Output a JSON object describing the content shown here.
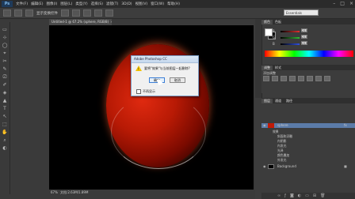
{
  "app": {
    "logo": "Ps"
  },
  "menu": [
    "文件(F)",
    "编辑(E)",
    "图像(I)",
    "图层(L)",
    "类型(Y)",
    "选择(S)",
    "滤镜(T)",
    "3D(D)",
    "视图(V)",
    "窗口(W)",
    "帮助(H)"
  ],
  "window_buttons": [
    "–",
    "□",
    "×"
  ],
  "options_bar": {
    "items": [
      "显示变换控件"
    ],
    "workspace": "Essentials"
  },
  "document": {
    "tab_title": "Untitled-1 @ 67.2% (sphere, RGB/8)",
    "close": "×"
  },
  "status_bar": {
    "zoom": "67%",
    "doc_info": "文档:2.63M/1.89M"
  },
  "dialog": {
    "title": "Adobe Photoshop CC",
    "message": "要将\"效果\"与当前图层一起删除?",
    "buttons": [
      "确定",
      "取消"
    ],
    "checkbox": "不再显示",
    "warning_glyph": "!"
  },
  "color_panel": {
    "tabs": [
      "颜色",
      "色板"
    ],
    "sliders": [
      {
        "label": "R",
        "value": "255",
        "color": "#e03030"
      },
      {
        "label": "G",
        "value": "255",
        "color": "#30c030"
      },
      {
        "label": "B",
        "value": "255",
        "color": "#3050e0"
      }
    ]
  },
  "adjustments_panel": {
    "tabs": [
      "调整",
      "样式"
    ],
    "subtitle": "添加调整"
  },
  "layers_panel": {
    "tabs": [
      "图层",
      "通道",
      "路径"
    ],
    "layers": [
      {
        "name": "sphere",
        "fx": "fx",
        "selected": true
      },
      {
        "name": "Background",
        "selected": false
      }
    ],
    "effects_header": "效果",
    "effects": [
      "斜面和浮雕",
      "内阴影",
      "内发光",
      "光泽",
      "颜色叠加",
      "外发光"
    ]
  },
  "tools": [
    "▭",
    "⊹",
    "◯",
    "⌖",
    "✂",
    "✎",
    "⎚",
    "✐",
    "◈",
    "▲",
    "T",
    "↖",
    "⬚",
    "✋",
    "⌕",
    "◐"
  ],
  "colors": {
    "selection": "#5b7ba8",
    "dialog_border": "#7a9cc4",
    "warning": "#f2c200"
  }
}
